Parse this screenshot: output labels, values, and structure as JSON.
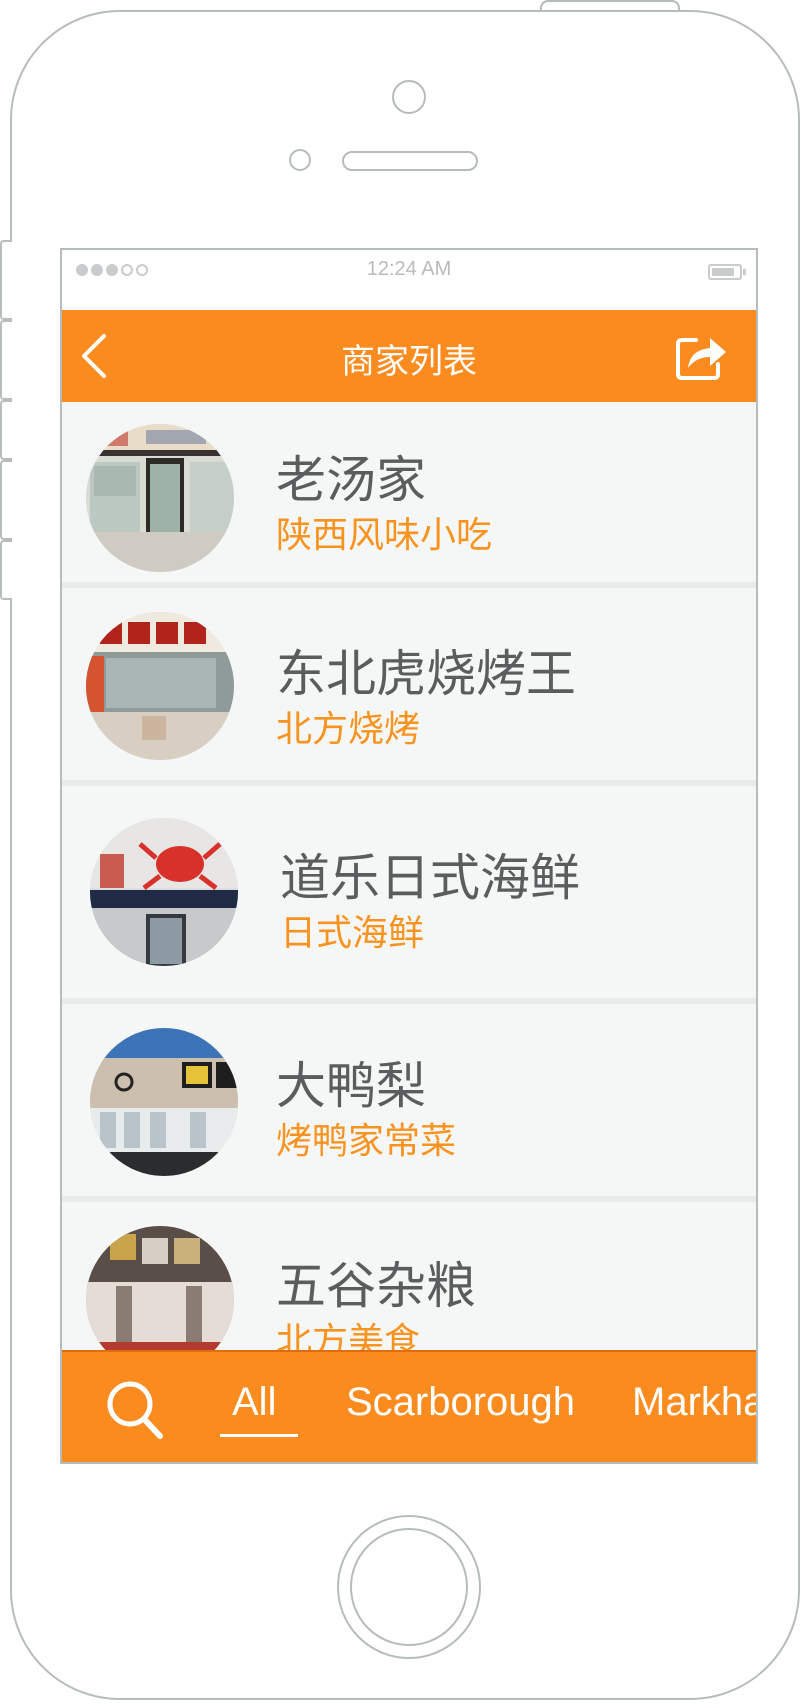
{
  "status_bar": {
    "time": "12:24 AM",
    "signal_dots_filled": 3,
    "signal_dots_total": 5,
    "battery_icon": "battery-icon"
  },
  "navbar": {
    "title": "商家列表",
    "back_icon": "chevron-left-icon",
    "share_icon": "share-icon"
  },
  "restaurants": [
    {
      "name": "老汤家",
      "category": "陕西风味小吃"
    },
    {
      "name": "东北虎烧烤王",
      "category": "北方烧烤"
    },
    {
      "name": "道乐日式海鲜",
      "category": "日式海鲜"
    },
    {
      "name": "大鸭梨",
      "category": "烤鸭家常菜"
    },
    {
      "name": "五谷杂粮",
      "category": "北方美食"
    }
  ],
  "tabbar": {
    "search_icon": "search-icon",
    "tabs": [
      "All",
      "Scarborough",
      "Markham"
    ],
    "active_tab": "All"
  },
  "colors": {
    "accent": "#fa8b1e",
    "subtitle": "#f7931e",
    "title_text": "#595d5d",
    "list_bg": "#f5f6f6"
  }
}
